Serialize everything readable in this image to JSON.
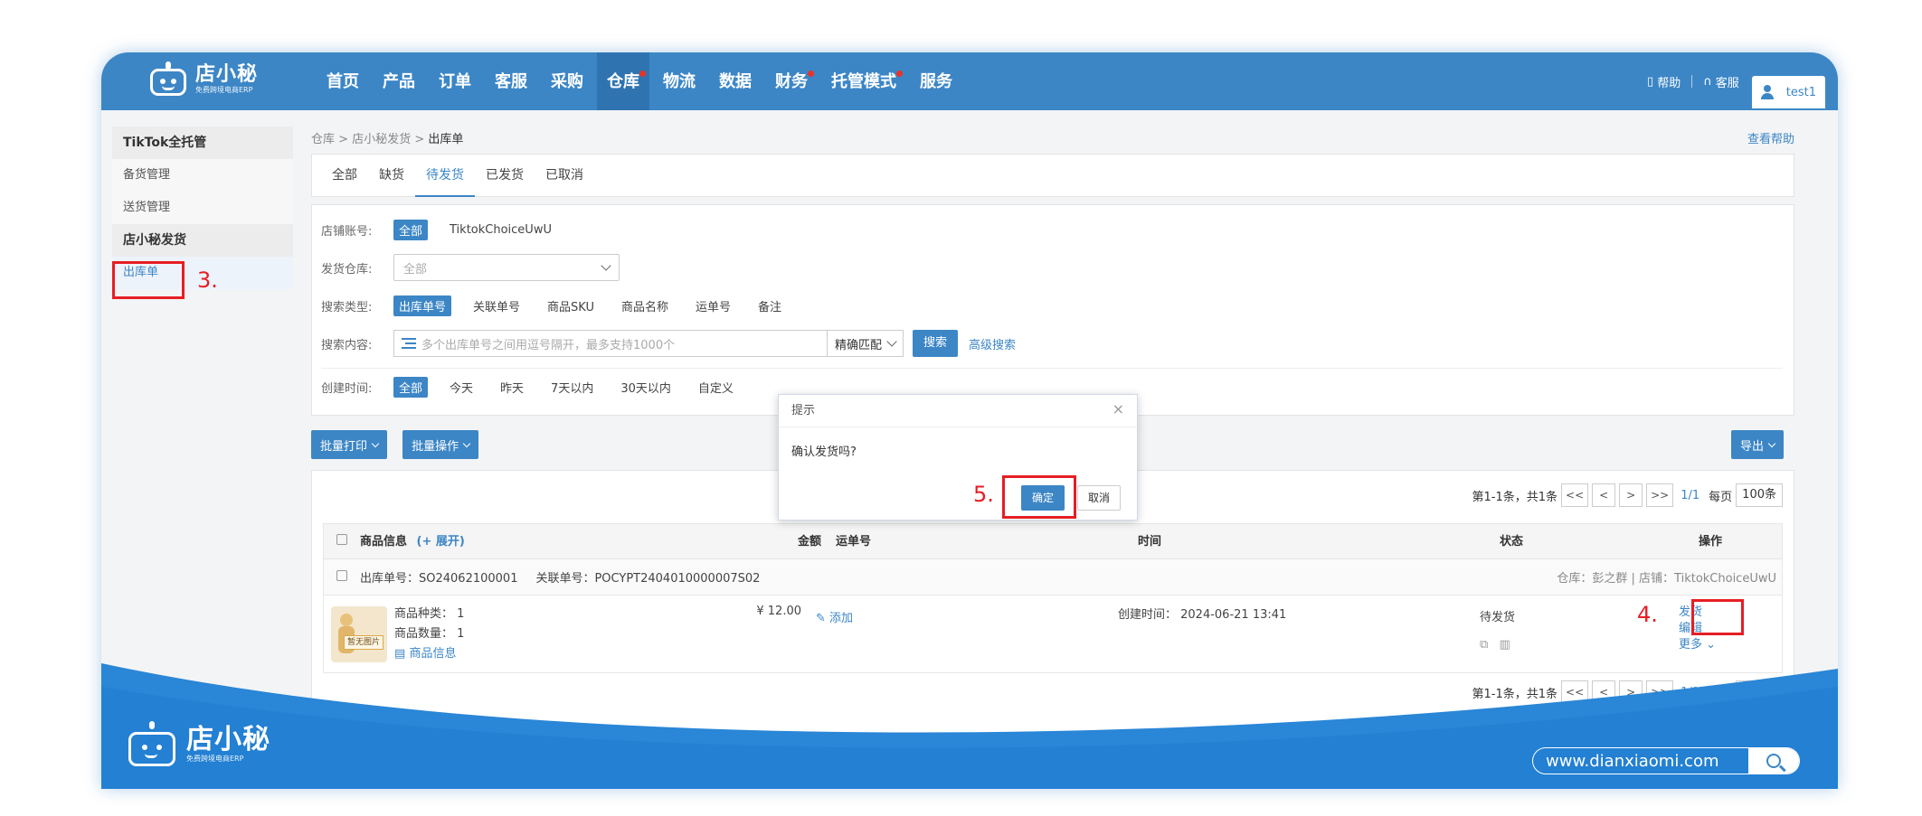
{
  "app": {
    "logo_name": "店小秘",
    "logo_sub": "免费跨境电商ERP"
  },
  "nav": [
    {
      "label": "首页",
      "active": false,
      "dot": false
    },
    {
      "label": "产品",
      "active": false,
      "dot": false
    },
    {
      "label": "订单",
      "active": false,
      "dot": false
    },
    {
      "label": "客服",
      "active": false,
      "dot": false
    },
    {
      "label": "采购",
      "active": false,
      "dot": false
    },
    {
      "label": "仓库",
      "active": true,
      "dot": true
    },
    {
      "label": "物流",
      "active": false,
      "dot": false
    },
    {
      "label": "数据",
      "active": false,
      "dot": false
    },
    {
      "label": "财务",
      "active": false,
      "dot": true
    },
    {
      "label": "托管模式",
      "active": false,
      "dot": true
    },
    {
      "label": "服务",
      "active": false,
      "dot": false
    }
  ],
  "top_right": {
    "help": "帮助",
    "service": "客服",
    "user": "test1"
  },
  "sidebar": {
    "group1": "TikTok全托管",
    "items1": [
      "备货管理",
      "送货管理"
    ],
    "group2": "店小秘发货",
    "active_item": "出库单"
  },
  "breadcrumb": {
    "p1": "仓库",
    "p2": "店小秘发货",
    "current": "出库单",
    "help": "查看帮助"
  },
  "tabs": [
    {
      "label": "全部",
      "active": false
    },
    {
      "label": "缺货",
      "active": false
    },
    {
      "label": "待发货",
      "active": true
    },
    {
      "label": "已发货",
      "active": false
    },
    {
      "label": "已取消",
      "active": false
    }
  ],
  "filters": {
    "store_label": "店铺账号:",
    "store_all": "全部",
    "store_name": "TiktokChoiceUwU",
    "warehouse_label": "发货仓库:",
    "warehouse_placeholder": "全部",
    "search_type_label": "搜索类型:",
    "search_types": [
      "出库单号",
      "关联单号",
      "商品SKU",
      "商品名称",
      "运单号",
      "备注"
    ],
    "search_content_label": "搜索内容:",
    "search_placeholder": "多个出库单号之间用逗号隔开，最多支持1000个",
    "match_mode": "精确匹配",
    "search_btn": "搜索",
    "advanced": "高级搜索",
    "time_label": "创建时间:",
    "time_options": [
      "全部",
      "今天",
      "昨天",
      "7天以内",
      "30天以内",
      "自定义"
    ]
  },
  "actions": {
    "batch_print": "批量打印",
    "batch_ops": "批量操作",
    "export": "导出"
  },
  "pager": {
    "summary": "第1-1条，共1条",
    "first": "<<",
    "prev": "<",
    "next": ">",
    "last": ">>",
    "page": "1/1",
    "per_page_label": "每页",
    "per_page": "100条"
  },
  "table": {
    "headers": {
      "product": "商品信息",
      "expand": "(+ 展开)",
      "amount": "金额",
      "tracking": "运单号",
      "time": "时间",
      "status": "状态",
      "ops": "操作"
    },
    "order": {
      "order_no": "出库单号：SO24062100001",
      "related_no": "关联单号：POCYPT2404010000007S02",
      "meta": "仓库：彭之群 | 店铺：TiktokChoiceUwU",
      "kinds": "商品种类：  1",
      "qty": "商品数量：  1",
      "info_link": "商品信息",
      "no_image": "暂无图片",
      "amount": "¥ 12.00",
      "add_tracking": "添加",
      "created": "创建时间：  2024-06-21 13:41",
      "status": "待发货",
      "op_ship": "发货",
      "op_edit": "编辑",
      "op_more": "更多"
    }
  },
  "modal": {
    "title": "提示",
    "close": "×",
    "message": "确认发货吗?",
    "ok": "确定",
    "cancel": "取消"
  },
  "annotations": {
    "step3": "3.",
    "step4": "4.",
    "step5": "5."
  },
  "footer": {
    "logo_name": "店小秘",
    "logo_sub": "免费跨境电商ERP",
    "url": "www.dianxiaomi.com"
  },
  "colors": {
    "primary": "#3c86c6",
    "annotation": "#e61e24"
  }
}
